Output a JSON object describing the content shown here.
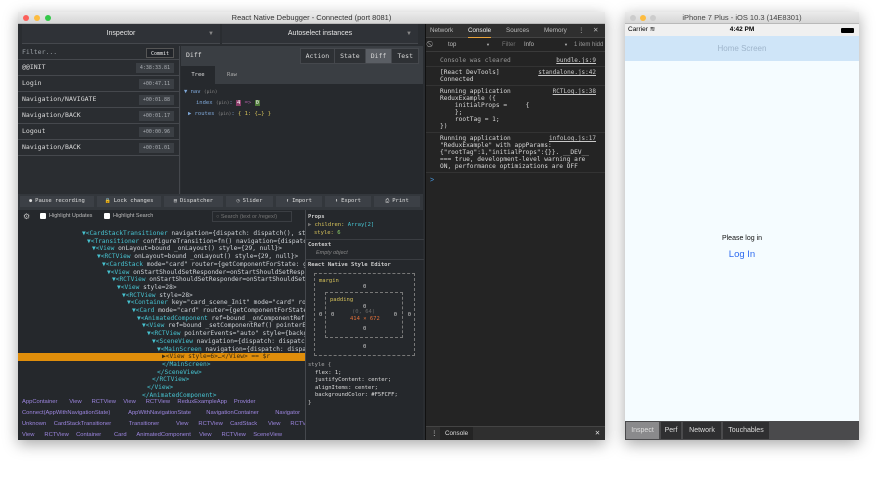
{
  "debugger": {
    "title": "React Native Debugger - Connected (port 8081)",
    "inspector_select": "Inspector",
    "instance_select": "Autoselect instances",
    "filter_placeholder": "Filter...",
    "commit_label": "Commit",
    "actions": [
      {
        "name": "@@INIT",
        "time": "4:38:33.81"
      },
      {
        "name": "Login",
        "time": "+00:47.11"
      },
      {
        "name": "Navigation/NAVIGATE",
        "time": "+00:01.88"
      },
      {
        "name": "Navigation/BACK",
        "time": "+00:01.17"
      },
      {
        "name": "Logout",
        "time": "+00:00.96"
      },
      {
        "name": "Navigation/BACK",
        "time": "+00:01.01"
      }
    ],
    "monitor_title": "Diff",
    "monitor_tabs": [
      "Action",
      "State",
      "Diff",
      "Test"
    ],
    "active_monitor_tab": "Diff",
    "sub_tabs": [
      "Tree",
      "Raw"
    ],
    "diff": {
      "nav": "nav",
      "pin": "(pin)",
      "index": "index",
      "old": "4",
      "arrow": "=>",
      "new": "0",
      "routes": "routes",
      "routes_val": "{ 1: {…} }"
    },
    "toolbar": [
      "Pause recording",
      "Lock changes",
      "Dispatcher",
      "Slider",
      "Import",
      "Export",
      "Print"
    ],
    "highlight_updates": "Highlight Updates",
    "highlight_search": "Highlight Search",
    "search_placeholder": "Search (text or /regex/)",
    "tree": [
      {
        "d": 0,
        "t": "▼<CardStackTransitioner",
        "r": " navigation={dispatch: dispatch(), state: {…"
      },
      {
        "d": 1,
        "t": "▼<Transitioner",
        "r": " configureTransition=fn() navigation={dispatch: dis"
      },
      {
        "d": 2,
        "t": "▼<View",
        "r": " onLayout=bound _onLayout() style={29, null}>"
      },
      {
        "d": 3,
        "t": "▼<RCTView",
        "r": " onLayout=bound _onLayout() style={29, null}>"
      },
      {
        "d": 4,
        "t": "▼<CardStack",
        "r": " mode=\"card\" router={getComponentForState: getComp"
      },
      {
        "d": 5,
        "t": "▼<View",
        "r": " onStartShouldSetResponder=onStartShouldSetResponder("
      },
      {
        "d": 6,
        "t": "▼<RCTView",
        "r": " onStartShouldSetResponder=onStartShouldSetRespon"
      },
      {
        "d": 7,
        "t": "▼<View",
        "r": " style=28>"
      },
      {
        "d": 8,
        "t": "▼<RCTView",
        "r": " style=28>"
      },
      {
        "d": 9,
        "t": "▼<Container",
        "r": " key=\"card_scene_Init\" mode=\"card\" router={"
      },
      {
        "d": 10,
        "t": "▼<Card",
        "r": " mode=\"card\" router={getComponentForState: ge"
      },
      {
        "d": 11,
        "t": "▼<AnimatedComponent",
        "r": " ref=bound _onComponentRef() po"
      },
      {
        "d": 12,
        "t": "▼<View",
        "r": " ref=bound _setComponentRef() pointerEvents"
      },
      {
        "d": 13,
        "t": "▼<RCTView",
        "r": " pointerEvents=\"auto\" style={backgroun"
      },
      {
        "d": 14,
        "t": "▼<SceneView",
        "r": " navigation={dispatch: dispatch(),"
      },
      {
        "d": 15,
        "t": "▼<MainScreen",
        "r": " navigation={dispatch: dispatch("
      },
      {
        "d": 16,
        "t": "▶<View",
        "r": " style=6>…</View> == $r",
        "sel": true
      },
      {
        "d": 16,
        "t": "</MainScreen>",
        "r": ""
      },
      {
        "d": 15,
        "t": "</SceneView>",
        "r": ""
      },
      {
        "d": 14,
        "t": "</RCTView>",
        "r": ""
      },
      {
        "d": 13,
        "t": "</View>",
        "r": ""
      },
      {
        "d": 12,
        "t": "</AnimatedComponent>",
        "r": ""
      }
    ],
    "breadcrumbs": [
      [
        "AppContainer",
        "View",
        "RCTView",
        "View",
        "RCTView",
        "ReduxExampleApp",
        "Provider"
      ],
      [
        "Connect(AppWithNavigationState)",
        "AppWithNavigationState",
        "NavigationContainer",
        "Navigator"
      ],
      [
        "Unknown",
        "CardStackTransitioner",
        "Transitioner",
        "View",
        "RCTView",
        "CardStack",
        "View",
        "RCTView"
      ],
      [
        "View",
        "RCTView",
        "Container",
        "Card",
        "AnimatedComponent",
        "View",
        "RCTView",
        "SceneView"
      ]
    ],
    "props": {
      "title": "Props",
      "children_key": "children:",
      "children_val": "Array[2]",
      "style_key": "style:",
      "style_val": "6",
      "context_title": "Context",
      "context_val": "Empty object",
      "editor_title": "React Native Style Editor",
      "margin": "margin",
      "padding": "padding",
      "zero": "0",
      "pos": "(0, 64)",
      "size": "414 × 672",
      "style_open": "style {",
      "style_lines": [
        "flex:  1;",
        "justifyContent:  center;",
        "alignItems:  center;",
        "backgroundColor:  #F5FCFF;"
      ],
      "style_close": "}"
    }
  },
  "console": {
    "tabs": [
      "Network",
      "Console",
      "Sources",
      "Memory"
    ],
    "active_tab": "Console",
    "context": "top",
    "filter_placeholder": "Filter",
    "level": "Info",
    "hidden": "1 item hidd",
    "messages": [
      {
        "text": "Console was cleared",
        "src": "bundle.js:9",
        "dim": true
      },
      {
        "text": "[React DevTools]\nConnected",
        "src": "standalone.js:42"
      },
      {
        "text": "Running application\nReduxExample ({\n    initialProps =     {\n    };\n    rootTag = 1;\n})",
        "src": "RCTLog.js:38"
      },
      {
        "text": "Running application\n\"ReduxExample\" with appParams:\n{\"rootTag\":1,\"initialProps\":{}}. __DEV__\n=== true, development-level warning are\nON, performance optimizations are OFF",
        "src": "infoLog.js:17"
      }
    ],
    "prompt": ">",
    "drawer_label": "Console"
  },
  "simulator": {
    "title": "iPhone 7 Plus - iOS 10.3 (14E8301)",
    "carrier": "Carrier",
    "time": "4:42 PM",
    "nav_title": "Home Screen",
    "message": "Please log in",
    "login_link": "Log In",
    "inspector_tabs": [
      "Inspect",
      "Perf",
      "Network",
      "Touchables"
    ],
    "active_inspector_tab": "Inspect",
    "colors": {
      "background": "#F5FCFF",
      "nav": "#CFE5F8",
      "link": "#2F6CF0",
      "selected_row": "#E08E0B"
    }
  }
}
